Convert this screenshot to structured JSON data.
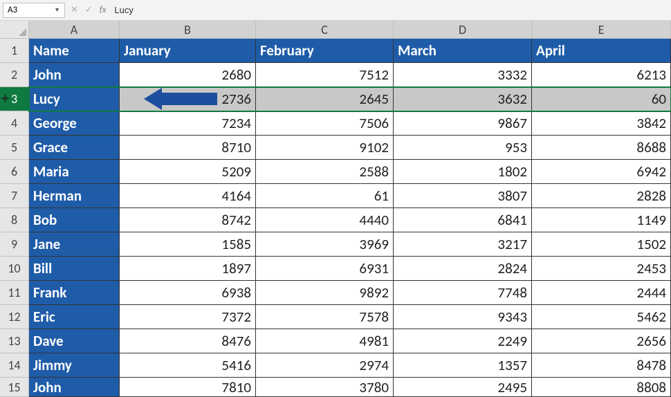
{
  "nameBox": "A3",
  "formulaValue": "Lucy",
  "columns": [
    "A",
    "B",
    "C",
    "D",
    "E"
  ],
  "monthHeaders": [
    "Name",
    "January",
    "February",
    "March",
    "April"
  ],
  "selectedRow": 3,
  "rows": [
    {
      "n": 1,
      "name": "Name",
      "vals": [
        "January",
        "February",
        "March",
        "April"
      ],
      "isHeader": true
    },
    {
      "n": 2,
      "name": "John",
      "vals": [
        "2680",
        "7512",
        "3332",
        "6213"
      ]
    },
    {
      "n": 3,
      "name": "Lucy",
      "vals": [
        "2736",
        "2645",
        "3632",
        "60"
      ]
    },
    {
      "n": 4,
      "name": "George",
      "vals": [
        "7234",
        "7506",
        "9867",
        "3842"
      ]
    },
    {
      "n": 5,
      "name": "Grace",
      "vals": [
        "8710",
        "9102",
        "953",
        "8688"
      ]
    },
    {
      "n": 6,
      "name": "Maria",
      "vals": [
        "5209",
        "2588",
        "1802",
        "6942"
      ]
    },
    {
      "n": 7,
      "name": "Herman",
      "vals": [
        "4164",
        "61",
        "3807",
        "2828"
      ]
    },
    {
      "n": 8,
      "name": "Bob",
      "vals": [
        "8742",
        "4440",
        "6841",
        "1149"
      ]
    },
    {
      "n": 9,
      "name": "Jane",
      "vals": [
        "1585",
        "3969",
        "3217",
        "1502"
      ]
    },
    {
      "n": 10,
      "name": "Bill",
      "vals": [
        "1897",
        "6931",
        "2824",
        "2453"
      ]
    },
    {
      "n": 11,
      "name": "Frank",
      "vals": [
        "6938",
        "9892",
        "7748",
        "2444"
      ]
    },
    {
      "n": 12,
      "name": "Eric",
      "vals": [
        "7372",
        "7578",
        "9343",
        "5462"
      ]
    },
    {
      "n": 13,
      "name": "Dave",
      "vals": [
        "8476",
        "4981",
        "2249",
        "2656"
      ]
    },
    {
      "n": 14,
      "name": "Jimmy",
      "vals": [
        "5416",
        "2974",
        "1357",
        "8478"
      ]
    },
    {
      "n": 15,
      "name": "John",
      "vals": [
        "7810",
        "3780",
        "2495",
        "8808"
      ]
    }
  ],
  "chart_data": {
    "type": "table",
    "title": "",
    "columns": [
      "Name",
      "January",
      "February",
      "March",
      "April"
    ],
    "rows": [
      [
        "John",
        2680,
        7512,
        3332,
        6213
      ],
      [
        "Lucy",
        2736,
        2645,
        3632,
        60
      ],
      [
        "George",
        7234,
        7506,
        9867,
        3842
      ],
      [
        "Grace",
        8710,
        9102,
        953,
        8688
      ],
      [
        "Maria",
        5209,
        2588,
        1802,
        6942
      ],
      [
        "Herman",
        4164,
        61,
        3807,
        2828
      ],
      [
        "Bob",
        8742,
        4440,
        6841,
        1149
      ],
      [
        "Jane",
        1585,
        3969,
        3217,
        1502
      ],
      [
        "Bill",
        1897,
        6931,
        2824,
        2453
      ],
      [
        "Frank",
        6938,
        9892,
        7748,
        2444
      ],
      [
        "Eric",
        7372,
        7578,
        9343,
        5462
      ],
      [
        "Dave",
        8476,
        4981,
        2249,
        2656
      ],
      [
        "Jimmy",
        5416,
        2974,
        1357,
        8478
      ],
      [
        "John",
        7810,
        3780,
        2495,
        8808
      ]
    ]
  }
}
